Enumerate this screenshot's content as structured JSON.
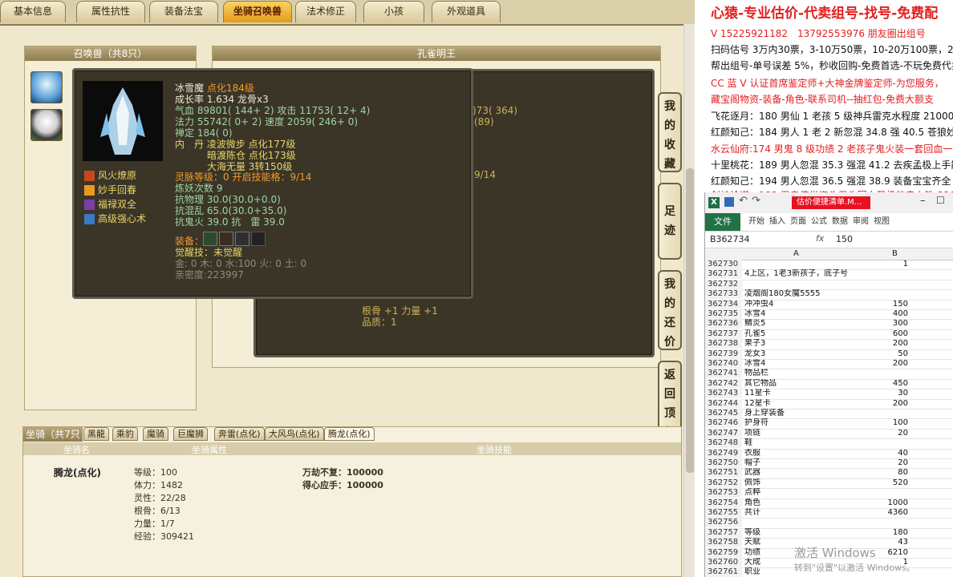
{
  "tabs": [
    "基本信息",
    "属性抗性",
    "装备法宝",
    "坐骑召唤兽",
    "法术修正",
    "小孩",
    "外观道具"
  ],
  "active_tab": 3,
  "summon_panel": {
    "header": "召唤兽（共8只）"
  },
  "right_panel": {
    "header": "孔雀明王"
  },
  "pet": {
    "name": "冰雪魔",
    "tag": "点化184级",
    "growth": "成长率 1.634 龙骨x3",
    "hp": "气血 89801( 144+ 2) 攻击 11753( 12+ 4)",
    "mp": "法力 55742( 0+ 2) 速度 2059( 246+ 0)",
    "zen": "禅定 184( 0)",
    "neidan1": "内　丹 凌波微步 点化177级",
    "neidan2": "暗渡陈仓 点化173级",
    "neidan3": "大海无量 3转150级",
    "spirit": "灵脉等级：0 开启技能格：9/14",
    "demon": "炼妖次数 9",
    "res1": "抗物理 30.0(30.0+0.0)",
    "res2": "抗混乱 65.0(30.0+35.0)",
    "res3": "抗鬼火 39.0 抗　雷 39.0",
    "equip_label": "装备：",
    "awaken": "觉醒技：未觉醒",
    "elements": "金: 0 木: 0 水:100 火: 0 土: 0",
    "intimacy": "亲密度:223997"
  },
  "skills": [
    "风火燎原",
    "妙手回春",
    "福禄双全",
    "高级强心术"
  ],
  "behind_stats": [
    ")73( 364)",
    "(89)",
    "9/14"
  ],
  "behind_bottom": [
    "根骨 +1 力量 +1",
    "品质：1"
  ],
  "side_buttons": [
    [
      "我",
      "的",
      "收",
      "藏"
    ],
    [
      "足",
      "迹"
    ],
    [
      "我",
      "的",
      "还",
      "价"
    ],
    [
      "返",
      "回",
      "顶",
      "部"
    ]
  ],
  "mount": {
    "header": "坐骑（共7只",
    "tabs": [
      "黑龍",
      "乘豹",
      "魔骑",
      "巨魔狮",
      "奔雷(点化)",
      "大风鸟(点化)",
      "腾龙(点化)"
    ],
    "active_tab": 6,
    "col_name": "坐骑名",
    "col_attr": "坐骑属性",
    "col_skill": "坐骑技能",
    "name": "腾龙(点化)",
    "stats": [
      "等级：100",
      "体力：1482",
      "灵性：22/28",
      "根骨：6/13",
      "力量：1/7",
      "经验：309421"
    ],
    "skill_list": [
      "万劫不复：100000",
      "得心应手：100000"
    ]
  },
  "overlay": {
    "title": "心猿-专业估价-代卖组号-找号-免费配",
    "lines": [
      {
        "t": "V 15225921182　13792553976 朋友圈出组号",
        "red": true
      },
      {
        "t": "扫码估号 3万内30票，3-10万50票，10-20万100票，20以上 15",
        "red": false
      },
      {
        "t": "帮出组号-单号误差 5%，秒收回购-免费首选-不玩免费代卖",
        "red": false
      },
      {
        "t": "CC 蓝 V 认证首席鉴定师+大神金牌鉴定师-为您服务，",
        "red": true
      },
      {
        "t": "藏宝阁物资-装备-角色-联系司机--抽红包-免费大额支",
        "red": true
      },
      {
        "t": "飞花逐月：180 男仙 1 老孩 5 级神兵雷克水程度 21000-",
        "red": false
      },
      {
        "t": "红颜知己：184 男人 1 老 2 新忽混 34.8 强 40.5 苍狼妙音 255",
        "red": false
      },
      {
        "t": "水云仙府:174 男鬼 8 级功绩 2 老孩子鬼火装一套回血一套 4",
        "red": true
      },
      {
        "t": "十里桃花：189 男人忽混 35.3 强混 41.2 去疾孟极上手能玩 2",
        "red": false
      },
      {
        "t": "红颜知己：194 男人忽混 36.5 强混 38.9 装备宝宝齐全 27500",
        "red": false
      },
      {
        "t": "剑神论道：188 男鬼传世资头男头回血圣极的赤心珠 32000",
        "red": true
      }
    ]
  },
  "excel": {
    "tooltip": "估价便捷清单.M...",
    "ribbon": [
      "文件",
      "开始",
      "插入",
      "页面",
      "公式",
      "数据",
      "审阅",
      "视图"
    ],
    "namebox": "B362734",
    "fx": "fx",
    "formula": "150",
    "col_a": "A",
    "col_b": "B",
    "rows": [
      [
        "362730",
        "",
        "1"
      ],
      [
        "362731",
        "4上区，1老3新孩子，底子号",
        ""
      ],
      [
        "362732",
        "",
        ""
      ],
      [
        "362733",
        "凌烟阁180女魔5555",
        ""
      ],
      [
        "362734",
        "冲冲虫4",
        "150"
      ],
      [
        "362735",
        "冰雪4",
        "400"
      ],
      [
        "362736",
        "鯖炎5",
        "300"
      ],
      [
        "362737",
        "孔雀5",
        "600"
      ],
      [
        "362738",
        "果子3",
        "200"
      ],
      [
        "362739",
        "龙女3",
        "50"
      ],
      [
        "362740",
        "冰雪4",
        "200"
      ],
      [
        "362741",
        "物品栏",
        ""
      ],
      [
        "362742",
        "其它物品",
        "450"
      ],
      [
        "362743",
        "11星卡",
        "30"
      ],
      [
        "362744",
        "12星卡",
        "200"
      ],
      [
        "362745",
        "身上穿装备",
        ""
      ],
      [
        "362746",
        "护身符",
        "100"
      ],
      [
        "362747",
        "项链",
        "20"
      ],
      [
        "362748",
        "鞋",
        ""
      ],
      [
        "362749",
        "衣服",
        "40"
      ],
      [
        "362750",
        "帽子",
        "20"
      ],
      [
        "362751",
        "武器",
        "80"
      ],
      [
        "362752",
        "佩饰",
        "520"
      ],
      [
        "362753",
        "点粹",
        ""
      ],
      [
        "362754",
        "角色",
        "1000"
      ],
      [
        "362755",
        "共计",
        "4360"
      ],
      [
        "362756",
        "",
        ""
      ],
      [
        "362757",
        "等级",
        "180"
      ],
      [
        "362758",
        "天赋",
        "43"
      ],
      [
        "362759",
        "功绩",
        "6210"
      ],
      [
        "362760",
        "大成",
        "1"
      ],
      [
        "362761",
        "职业",
        ""
      ]
    ]
  },
  "watermark": {
    "line1": "激活 Windows",
    "line2": "转到\"设置\"以激活 Windows。"
  }
}
